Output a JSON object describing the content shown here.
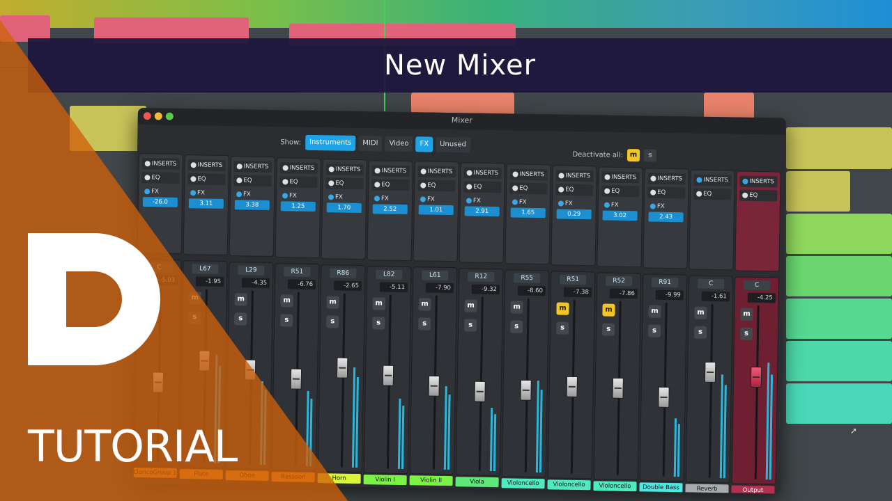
{
  "banner": {
    "title": "New Mixer"
  },
  "mixer": {
    "window_title": "Mixer",
    "show_label": "Show:",
    "filters": [
      {
        "label": "Instruments",
        "active": true
      },
      {
        "label": "MIDI",
        "active": false
      },
      {
        "label": "Video",
        "active": false
      },
      {
        "label": "FX",
        "active": true
      },
      {
        "label": "Unused",
        "active": false
      }
    ],
    "deactivate_label": "Deactivate all:",
    "deactivate_m": "m",
    "deactivate_s": "s",
    "labels": {
      "inserts": "INSERTS",
      "eq": "EQ",
      "fx": "FX",
      "mute": "m",
      "solo": "s"
    },
    "channels": [
      {
        "name": "DoricoGroup 1",
        "fx": "-26.0",
        "pan": "C",
        "gain": "-5.03",
        "color": "#f49a1c",
        "mute": false,
        "fader": 0.45,
        "meter": 0.0
      },
      {
        "name": "Flute",
        "fx": "3.11",
        "pan": "L67",
        "gain": "-1.95",
        "color": "#f49a1c",
        "mute": false,
        "fader": 0.6,
        "meter": 0.65
      },
      {
        "name": "Oboe",
        "fx": "3.38",
        "pan": "L29",
        "gain": "-4.35",
        "color": "#f49a1c",
        "mute": false,
        "fader": 0.55,
        "meter": 0.5
      },
      {
        "name": "Bassoon",
        "fx": "1.25",
        "pan": "R51",
        "gain": "-6.76",
        "color": "#f49a1c",
        "mute": false,
        "fader": 0.5,
        "meter": 0.45
      },
      {
        "name": "Horn",
        "fx": "1.70",
        "pan": "R86",
        "gain": "-2.65",
        "color": "#d8f53a",
        "mute": false,
        "fader": 0.58,
        "meter": 0.6
      },
      {
        "name": "Violin I",
        "fx": "2.52",
        "pan": "L82",
        "gain": "-5.11",
        "color": "#7af246",
        "mute": false,
        "fader": 0.54,
        "meter": 0.42
      },
      {
        "name": "Violin II",
        "fx": "1.01",
        "pan": "L61",
        "gain": "-7.90",
        "color": "#7af246",
        "mute": false,
        "fader": 0.48,
        "meter": 0.5
      },
      {
        "name": "Viola",
        "fx": "2.91",
        "pan": "R12",
        "gain": "-9.32",
        "color": "#5ee878",
        "mute": false,
        "fader": 0.45,
        "meter": 0.38
      },
      {
        "name": "Violoncello",
        "fx": "1.65",
        "pan": "R55",
        "gain": "-8.60",
        "color": "#4eeac0",
        "mute": false,
        "fader": 0.47,
        "meter": 0.55
      },
      {
        "name": "Violoncello",
        "fx": "0.29",
        "pan": "R51",
        "gain": "-7.38",
        "color": "#4eeac0",
        "mute": true,
        "fader": 0.5,
        "meter": 0.0
      },
      {
        "name": "Violoncello",
        "fx": "3.02",
        "pan": "R52",
        "gain": "-7.86",
        "color": "#4eeac0",
        "mute": true,
        "fader": 0.5,
        "meter": 0.0
      },
      {
        "name": "Double Bass",
        "fx": "2.43",
        "pan": "R91",
        "gain": "-9.99",
        "color": "#4ee8e0",
        "mute": false,
        "fader": 0.45,
        "meter": 0.35
      },
      {
        "name": "Reverb",
        "fx": "",
        "pan": "C",
        "gain": "-1.61",
        "color": "#a9abad",
        "mute": false,
        "fader": 0.62,
        "meter": 0.62
      },
      {
        "name": "Output",
        "fx": "",
        "pan": "C",
        "gain": "-4.25",
        "color": "#b33050",
        "mute": false,
        "fader": 0.6,
        "meter": 0.7
      }
    ]
  },
  "overlay": {
    "tutorial_label": "TUTORIAL"
  },
  "colors": {
    "accent": "#1ea4e6",
    "mute_active": "#f3c623",
    "orange": "#ce600a",
    "banner": "#1c163c"
  }
}
